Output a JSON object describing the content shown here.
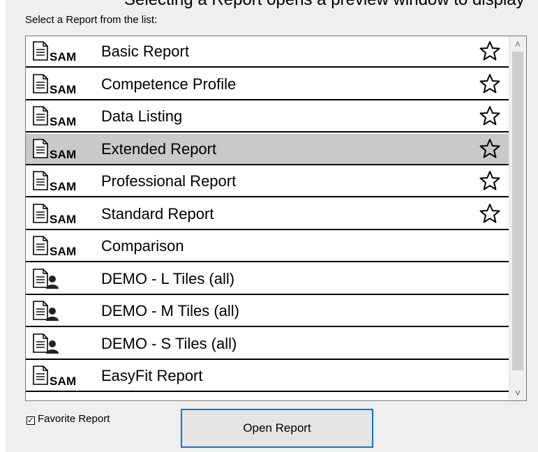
{
  "header": {
    "cutoff_text": "Selecting a Report opens a preview window to display",
    "prompt": "Select a Report from the list:"
  },
  "reports": [
    {
      "name": "Basic Report",
      "icon": "sam",
      "favorite": true,
      "selected": false
    },
    {
      "name": "Competence Profile",
      "icon": "sam",
      "favorite": true,
      "selected": false
    },
    {
      "name": "Data Listing",
      "icon": "sam",
      "favorite": true,
      "selected": false
    },
    {
      "name": "Extended Report",
      "icon": "sam",
      "favorite": true,
      "selected": true
    },
    {
      "name": "Professional Report",
      "icon": "sam",
      "favorite": true,
      "selected": false
    },
    {
      "name": "Standard Report",
      "icon": "sam",
      "favorite": true,
      "selected": false
    },
    {
      "name": "Comparison",
      "icon": "sam",
      "favorite": false,
      "selected": false
    },
    {
      "name": "DEMO - L Tiles (all)",
      "icon": "person",
      "favorite": false,
      "selected": false
    },
    {
      "name": "DEMO - M Tiles (all)",
      "icon": "person",
      "favorite": false,
      "selected": false
    },
    {
      "name": "DEMO - S Tiles (all)",
      "icon": "person",
      "favorite": false,
      "selected": false
    },
    {
      "name": "EasyFit Report",
      "icon": "sam",
      "favorite": false,
      "selected": false
    }
  ],
  "icon_tag": "SAM",
  "footer": {
    "favorite_label": "Favorite Report",
    "favorite_checked": true,
    "open_button": "Open Report"
  },
  "colors": {
    "accent": "#0078d7",
    "selected_row": "#c9c9c9"
  }
}
